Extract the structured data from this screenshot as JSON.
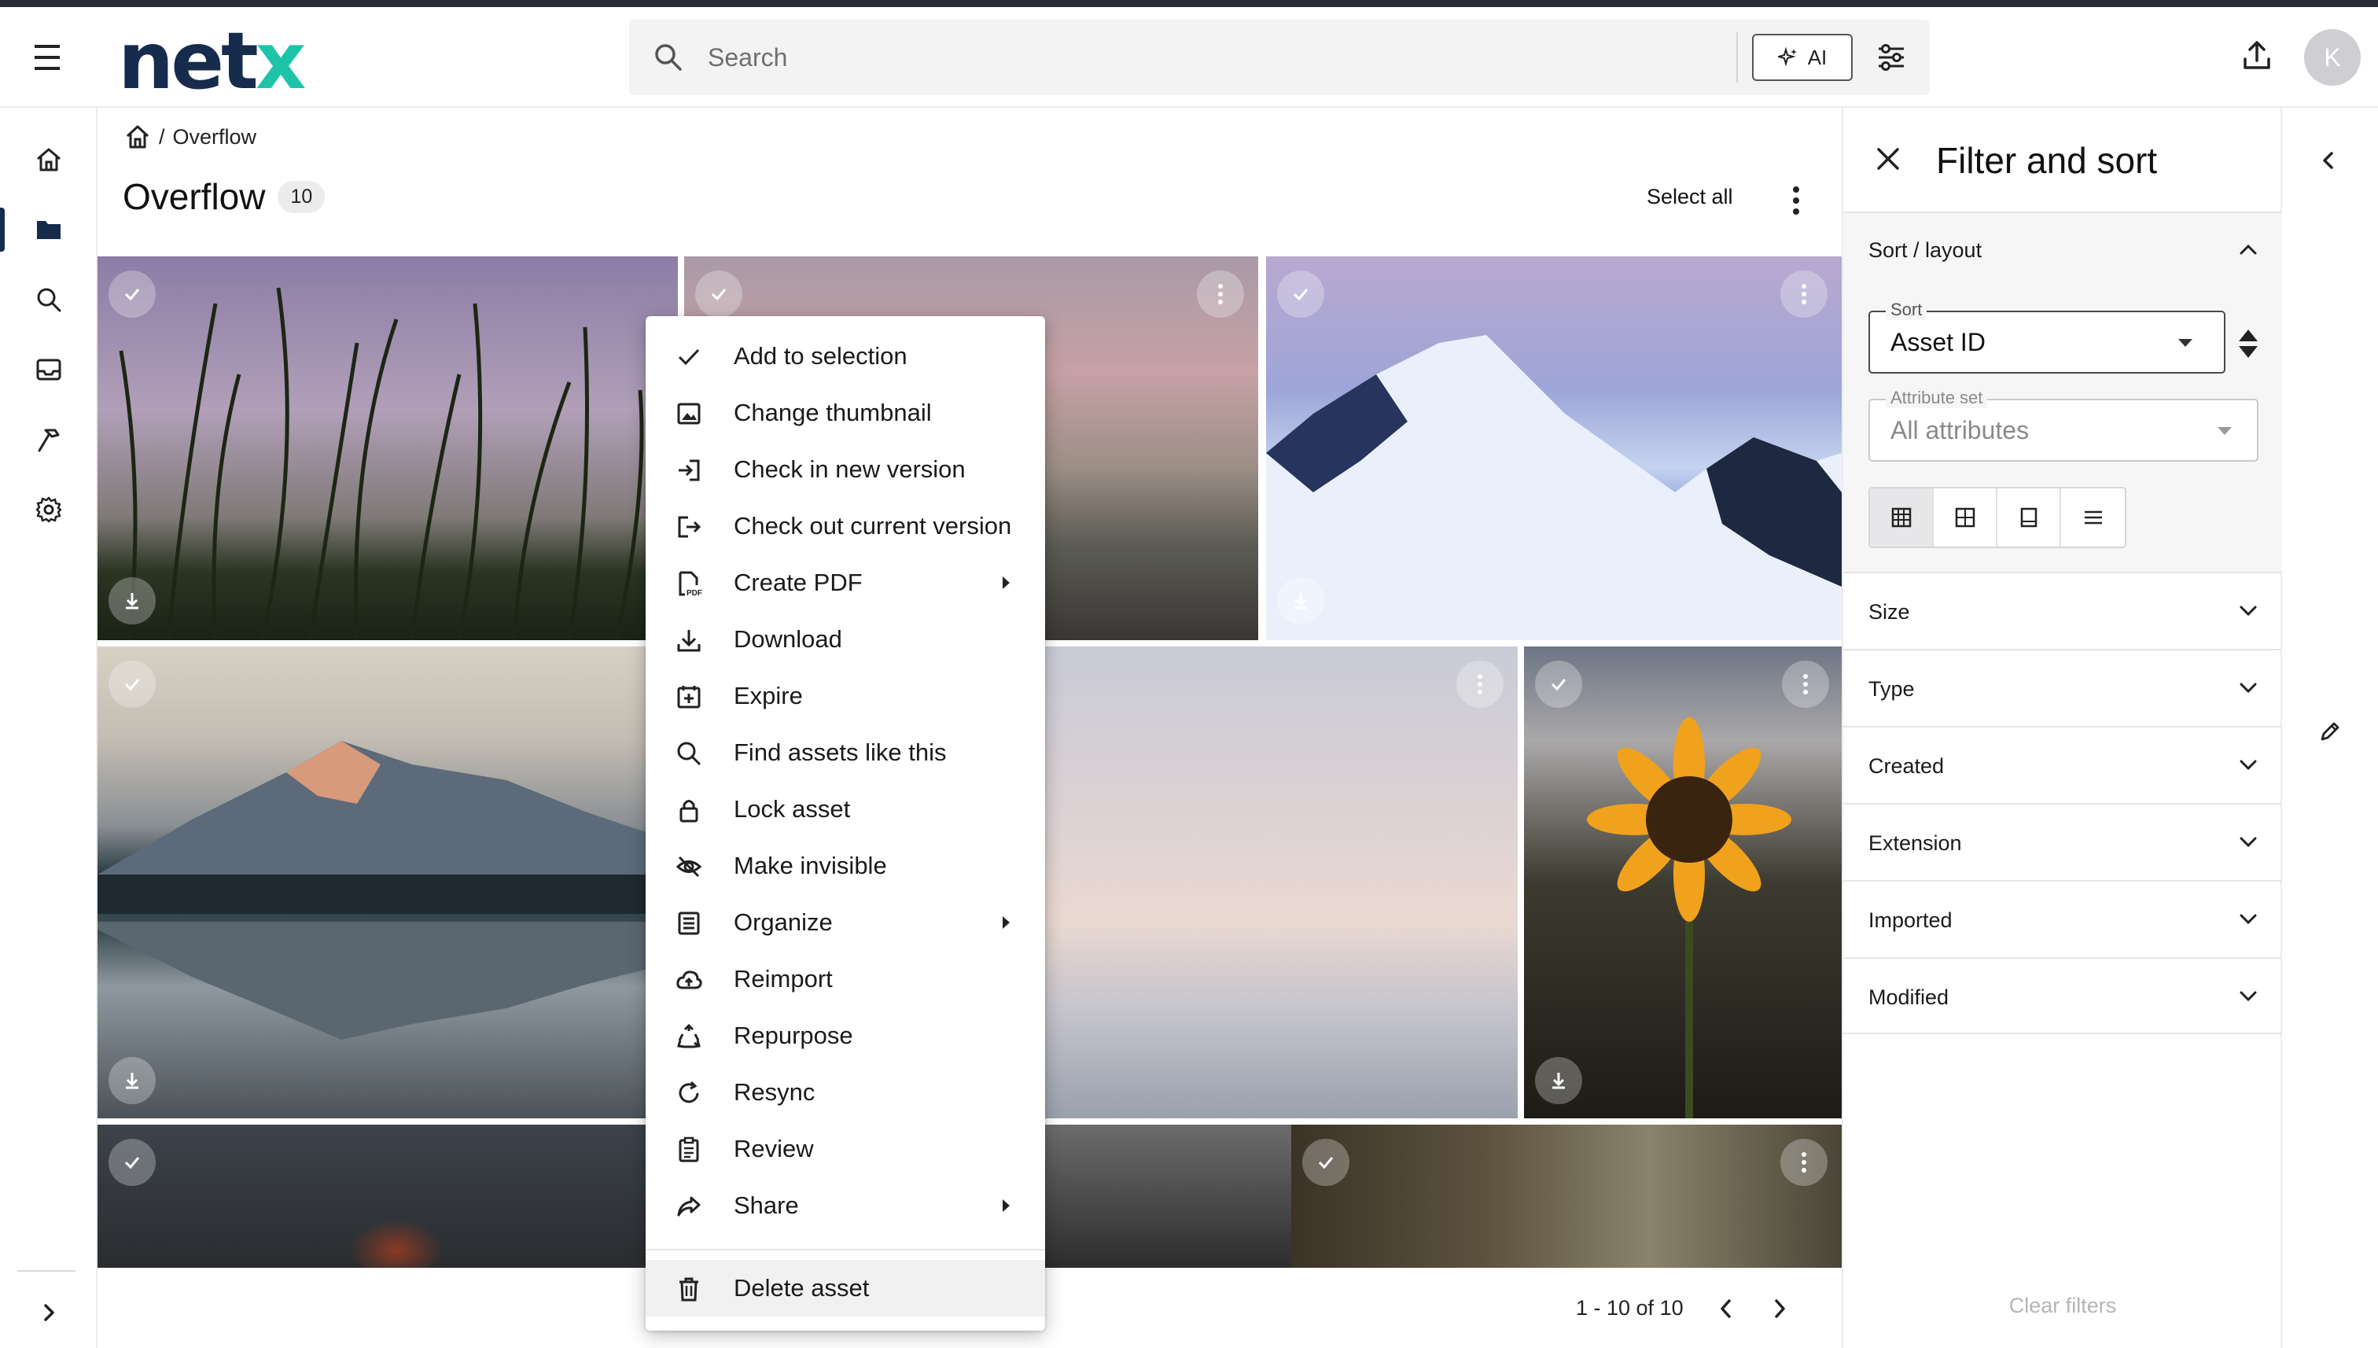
{
  "header": {
    "logo_main": "net",
    "logo_accent": "x",
    "search_placeholder": "Search",
    "ai_label": "AI",
    "avatar_initial": "K"
  },
  "breadcrumb": {
    "separator": "/",
    "current": "Overflow"
  },
  "page": {
    "title": "Overflow",
    "count": "10",
    "select_all": "Select all"
  },
  "pager": {
    "range": "1 - 10 of 10"
  },
  "context_menu": {
    "items": [
      {
        "label": "Add to selection",
        "icon": "check-icon",
        "submenu": false
      },
      {
        "label": "Change thumbnail",
        "icon": "image-icon",
        "submenu": false
      },
      {
        "label": "Check in new version",
        "icon": "check-in-icon",
        "submenu": false
      },
      {
        "label": "Check out current version",
        "icon": "check-out-icon",
        "submenu": false
      },
      {
        "label": "Create PDF",
        "icon": "pdf-icon",
        "submenu": true
      },
      {
        "label": "Download",
        "icon": "download-icon",
        "submenu": false
      },
      {
        "label": "Expire",
        "icon": "expire-icon",
        "submenu": false
      },
      {
        "label": "Find assets like this",
        "icon": "search-icon",
        "submenu": false
      },
      {
        "label": "Lock asset",
        "icon": "lock-icon",
        "submenu": false
      },
      {
        "label": "Make invisible",
        "icon": "eye-off-icon",
        "submenu": false
      },
      {
        "label": "Organize",
        "icon": "organize-icon",
        "submenu": true
      },
      {
        "label": "Reimport",
        "icon": "cloud-upload-icon",
        "submenu": false
      },
      {
        "label": "Repurpose",
        "icon": "recycle-icon",
        "submenu": false
      },
      {
        "label": "Resync",
        "icon": "resync-icon",
        "submenu": false
      },
      {
        "label": "Review",
        "icon": "clipboard-icon",
        "submenu": false
      },
      {
        "label": "Share",
        "icon": "share-icon",
        "submenu": true
      }
    ],
    "delete_label": "Delete asset"
  },
  "filter_panel": {
    "title": "Filter and sort",
    "sort_layout_label": "Sort / layout",
    "sort_label": "Sort",
    "sort_value": "Asset ID",
    "attribute_set_label": "Attribute set",
    "attribute_set_value": "All attributes",
    "sections": [
      "Size",
      "Type",
      "Created",
      "Extension",
      "Imported",
      "Modified"
    ],
    "clear_filters": "Clear filters"
  },
  "colors": {
    "brand_dark": "#172b4d",
    "brand_accent": "#1ec4a8"
  }
}
